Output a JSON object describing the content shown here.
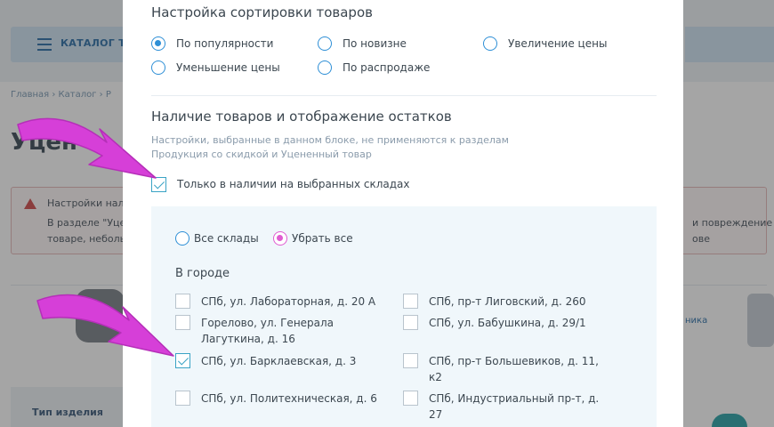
{
  "background": {
    "catalog_label": "КАТАЛОГ ТО",
    "breadcrumb": "Главная  ›  Каталог  ›  Р",
    "page_title": "Уцен",
    "alert": {
      "line1": "Настройки нал",
      "line2": "В разделе \"Уце",
      "line3": "товаре, небольш",
      "right1": "и повреждение у",
      "right2": "ове"
    },
    "right_link": "ника",
    "filter_label": "Тип изделия"
  },
  "modal": {
    "sort": {
      "title": "Настройка сортировки товаров",
      "options": [
        {
          "label": "По популярности",
          "selected": true
        },
        {
          "label": "По новизне",
          "selected": false
        },
        {
          "label": "Увеличение цены",
          "selected": false
        },
        {
          "label": "Уменьшение цены",
          "selected": false
        },
        {
          "label": "По распродаже",
          "selected": false
        }
      ]
    },
    "stock": {
      "title": "Наличие товаров и отображение остатков",
      "note_line1": "Настройки, выбранные в данном блоке, не применяются к разделам",
      "note_line2": "Продукция со скидкой и Уцененный товар",
      "only_in_stock_label": "Только в наличии на выбранных складах",
      "only_in_stock_checked": true
    },
    "stores": {
      "all_label": "Все склады",
      "remove_all_label": "Убрать все",
      "remove_all_selected": true,
      "city_title": "В городе",
      "items": [
        {
          "label_lines": [
            "СПб, ул. Лабораторная, д. 20 А"
          ],
          "checked": false
        },
        {
          "label_lines": [
            "СПб, пр-т Лиговский, д. 260"
          ],
          "checked": false
        },
        {
          "label_lines": [
            "Горелово, ул. Генерала",
            "Лагуткина, д. 16"
          ],
          "checked": false
        },
        {
          "label_lines": [
            "СПб, ул. Бабушкина, д. 29/1"
          ],
          "checked": false
        },
        {
          "label_lines": [
            "СПб, ул. Барклаевская, д. 3"
          ],
          "checked": true
        },
        {
          "label_lines": [
            "СПб, пр-т Большевиков, д. 11,",
            "к2"
          ],
          "checked": false
        },
        {
          "label_lines": [
            "СПб, ул. Политехническая, д. 6"
          ],
          "checked": false
        },
        {
          "label_lines": [
            "СПб, Индустриальный пр-т, д.",
            "27"
          ],
          "checked": false
        }
      ]
    }
  },
  "colors": {
    "accent_blue": "#2e8fd6",
    "check_teal": "#3aa3c5",
    "pink_accent": "#e05cd1",
    "annotation_arrow": "#d63fd8"
  }
}
